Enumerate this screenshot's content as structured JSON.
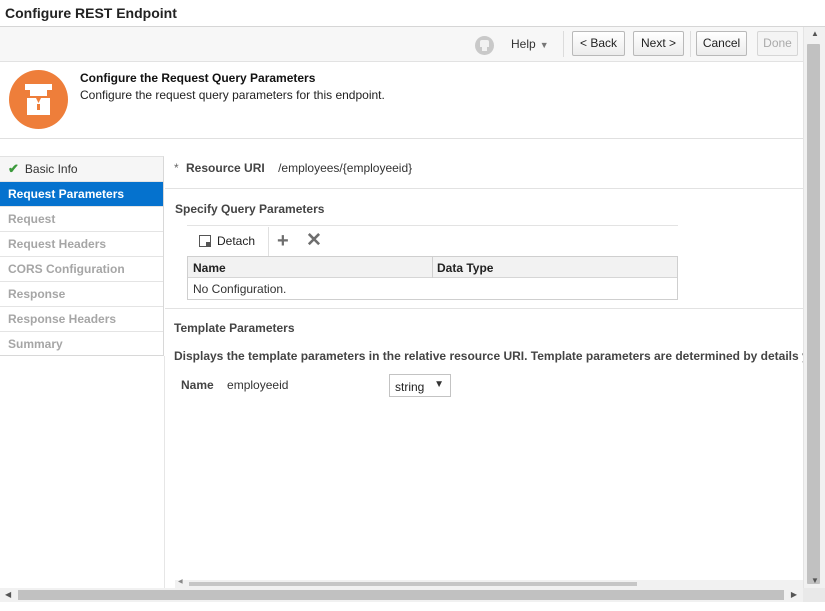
{
  "window": {
    "title": "Configure REST Endpoint"
  },
  "toolbar": {
    "help_label": "Help",
    "back_label": "< Back",
    "next_label": "Next >",
    "cancel_label": "Cancel",
    "done_label": "Done"
  },
  "header": {
    "title": "Configure the Request Query Parameters",
    "subtitle": "Configure the request query parameters for this endpoint.",
    "icon": "endpoint-user-icon",
    "icon_color": "#ee7e3a"
  },
  "nav": {
    "items": [
      {
        "label": "Basic Info",
        "state": "done"
      },
      {
        "label": "Request Parameters",
        "state": "active"
      },
      {
        "label": "Request",
        "state": "disabled"
      },
      {
        "label": "Request Headers",
        "state": "disabled"
      },
      {
        "label": "CORS Configuration",
        "state": "disabled"
      },
      {
        "label": "Response",
        "state": "disabled"
      },
      {
        "label": "Response Headers",
        "state": "disabled"
      },
      {
        "label": "Summary",
        "state": "disabled"
      }
    ],
    "active_color": "#0572ce"
  },
  "main": {
    "resource_uri": {
      "required_mark": "*",
      "label": "Resource URI",
      "value": "/employees/{employeeid}"
    },
    "query_params": {
      "title": "Specify Query Parameters",
      "detach_label": "Detach",
      "add_icon": "plus-icon",
      "delete_icon": "x-icon",
      "columns": [
        "Name",
        "Data Type"
      ],
      "empty_text": "No Configuration."
    },
    "template_params": {
      "title": "Template Parameters",
      "description": "Displays the template parameters in the relative resource URI. Template parameters are determined by details you specified",
      "rows": [
        {
          "label": "Name",
          "name": "employeeid",
          "type": "string"
        }
      ]
    }
  }
}
